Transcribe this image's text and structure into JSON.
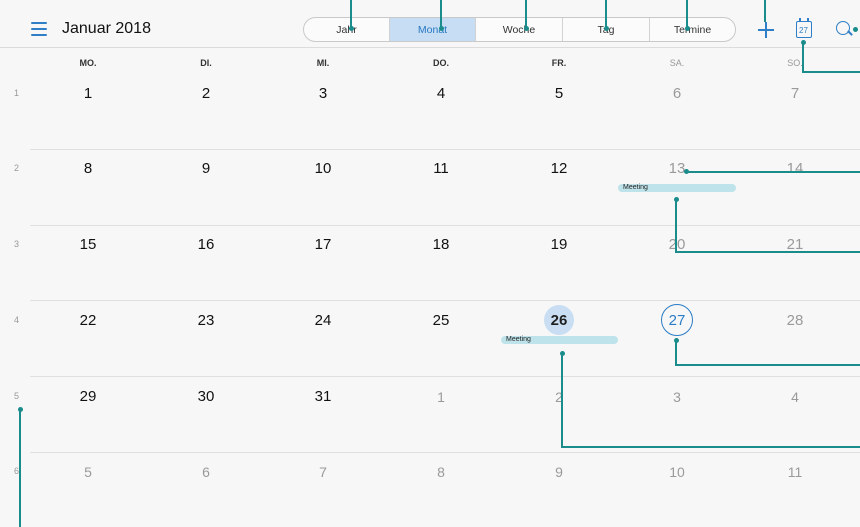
{
  "header": {
    "title": "Januar 2018",
    "tabs": [
      {
        "label": "Jahr",
        "active": false
      },
      {
        "label": "Monat",
        "active": true
      },
      {
        "label": "Woche",
        "active": false
      },
      {
        "label": "Tag",
        "active": false
      },
      {
        "label": "Termine",
        "active": false
      }
    ],
    "today_icon_number": "27",
    "accent_color": "#2e7fc7"
  },
  "weekdays": [
    "MO.",
    "DI.",
    "MI.",
    "DO.",
    "FR.",
    "SA.",
    "SO."
  ],
  "weeks": [
    {
      "number": "1",
      "days": [
        "1",
        "2",
        "3",
        "4",
        "5",
        "6",
        "7"
      ]
    },
    {
      "number": "2",
      "days": [
        "8",
        "9",
        "10",
        "11",
        "12",
        "13",
        "14"
      ]
    },
    {
      "number": "3",
      "days": [
        "15",
        "16",
        "17",
        "18",
        "19",
        "20",
        "21"
      ]
    },
    {
      "number": "4",
      "days": [
        "22",
        "23",
        "24",
        "25",
        "26",
        "27",
        "28"
      ]
    },
    {
      "number": "5",
      "days": [
        "29",
        "30",
        "31",
        "1",
        "2",
        "3",
        "4"
      ]
    },
    {
      "number": "6",
      "days": [
        "5",
        "6",
        "7",
        "8",
        "9",
        "10",
        "11"
      ]
    }
  ],
  "events": [
    {
      "label": "Meeting"
    },
    {
      "label": "Meeting"
    }
  ],
  "colors": {
    "today_fill": "#c9def2",
    "selected_ring": "#2a7dc6",
    "event_bar": "#bfe3ea",
    "callout": "#1a8c8c"
  }
}
